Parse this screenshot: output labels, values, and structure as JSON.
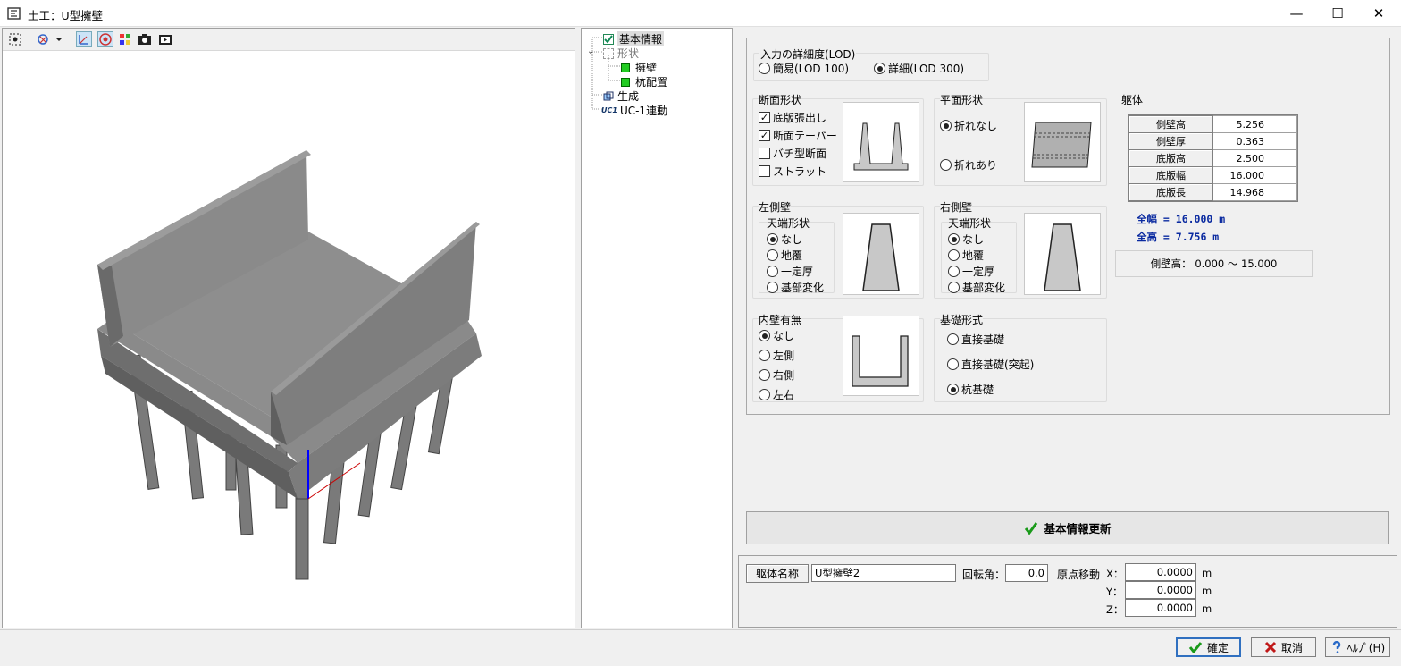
{
  "window": {
    "title": "土工：U型擁壁",
    "minimize": "—",
    "maximize": "☐",
    "close": "✕"
  },
  "tree": {
    "items": [
      {
        "label": "基本情報",
        "level": 0
      },
      {
        "label": "形状",
        "level": 0
      },
      {
        "label": "擁壁",
        "level": 1
      },
      {
        "label": "杭配置",
        "level": 1
      },
      {
        "label": "生成",
        "level": 0
      },
      {
        "label": "UC-1連動",
        "level": 0
      }
    ]
  },
  "lod": {
    "label": "入力の詳細度(LOD)",
    "options": [
      "簡易(LOD 100)",
      "詳細(LOD 300)"
    ],
    "selected": 1
  },
  "section": {
    "label": "断面形状",
    "checks": [
      {
        "label": "底版張出し",
        "checked": true
      },
      {
        "label": "断面テーパー",
        "checked": true
      },
      {
        "label": "バチ型断面",
        "checked": false
      },
      {
        "label": "ストラット",
        "checked": false
      }
    ]
  },
  "plan": {
    "label": "平面形状",
    "options": [
      "折れなし",
      "折れあり"
    ],
    "selected": 0
  },
  "body": {
    "label": "躯体",
    "rows": [
      {
        "name": "側壁高",
        "value": "5.256"
      },
      {
        "name": "側壁厚",
        "value": "0.363"
      },
      {
        "name": "底版高",
        "value": "2.500"
      },
      {
        "name": "底版幅",
        "value": "16.000"
      },
      {
        "name": "底版長",
        "value": "14.968"
      }
    ],
    "total_width": "全幅 = 16.000 m",
    "total_height": "全高 = 7.756 m",
    "range": "側壁高： 0.000 ～ 15.000"
  },
  "left_wall": {
    "label": "左側壁",
    "sub_label": "天端形状",
    "options": [
      "なし",
      "地覆",
      "一定厚",
      "基部変化"
    ],
    "selected": 0
  },
  "right_wall": {
    "label": "右側壁",
    "sub_label": "天端形状",
    "options": [
      "なし",
      "地覆",
      "一定厚",
      "基部変化"
    ],
    "selected": 0
  },
  "inner_wall": {
    "label": "内壁有無",
    "options": [
      "なし",
      "左側",
      "右側",
      "左右"
    ],
    "selected": 0
  },
  "foundation": {
    "label": "基礎形式",
    "options": [
      "直接基礎",
      "直接基礎(突起)",
      "杭基礎"
    ],
    "selected": 2
  },
  "update_button": "基本情報更新",
  "bottom": {
    "name_label": "躯体名称",
    "name_value": "U型擁壁2",
    "rotation_label": "回転角：",
    "rotation_value": "0.0",
    "origin_label": "原点移動",
    "x_label": "X：",
    "y_label": "Y：",
    "z_label": "Z：",
    "x_value": "0.0000",
    "y_value": "0.0000",
    "z_value": "0.0000",
    "unit": "m"
  },
  "buttons": {
    "ok": "確定",
    "cancel": "取消",
    "help": "ﾍﾙﾌﾟ(H)"
  }
}
